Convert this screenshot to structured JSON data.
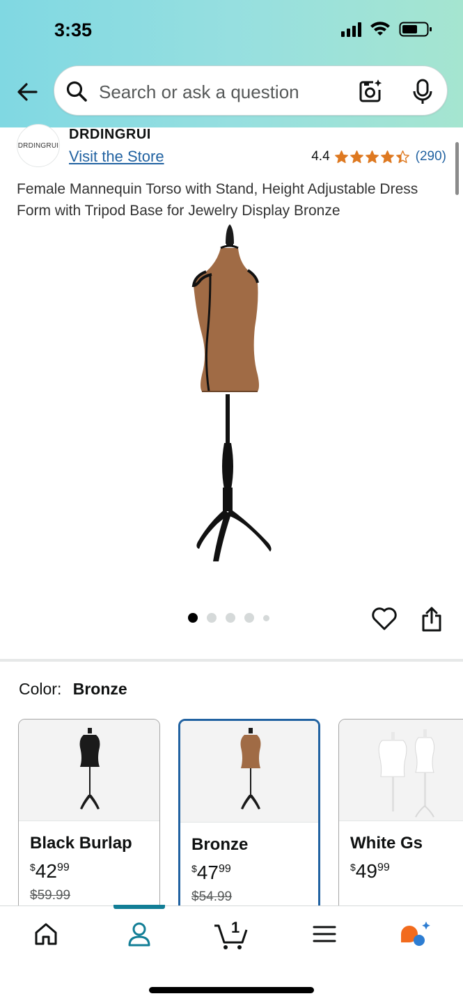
{
  "status_bar": {
    "time": "3:35"
  },
  "search": {
    "placeholder": "Search or ask a question"
  },
  "store": {
    "logo_text": "DRDINGRUI",
    "brand": "DRDINGRUI",
    "visit_label": "Visit the Store",
    "rating": "4.4",
    "rating_stars": 4.4,
    "review_count": "(290)"
  },
  "product": {
    "title": "Female Mannequin Torso with Stand, Height Adjustable Dress Form with Tripod Base for Jewelry Display Bronze",
    "image_count": 5,
    "active_image": 1
  },
  "color": {
    "label": "Color:",
    "selected": "Bronze",
    "options": [
      {
        "name": "Black Burlap",
        "currency": "$",
        "dollars": "42",
        "cents": "99",
        "list_price": "$59.99",
        "color": "#1a1a1a"
      },
      {
        "name": "Bronze",
        "currency": "$",
        "dollars": "47",
        "cents": "99",
        "list_price": "$54.99",
        "color": "#a8714a"
      },
      {
        "name": "White Gs",
        "currency": "$",
        "dollars": "49",
        "cents": "99",
        "list_price": "",
        "color": "#f2f2f2"
      }
    ]
  },
  "nav": {
    "items": [
      "home-icon",
      "account-icon",
      "cart-icon",
      "menu-icon",
      "rufus-icon"
    ],
    "cart_count": "1",
    "active": 1
  },
  "colors": {
    "link": "#2162a1",
    "star": "#de7921",
    "accent": "#127e96"
  }
}
